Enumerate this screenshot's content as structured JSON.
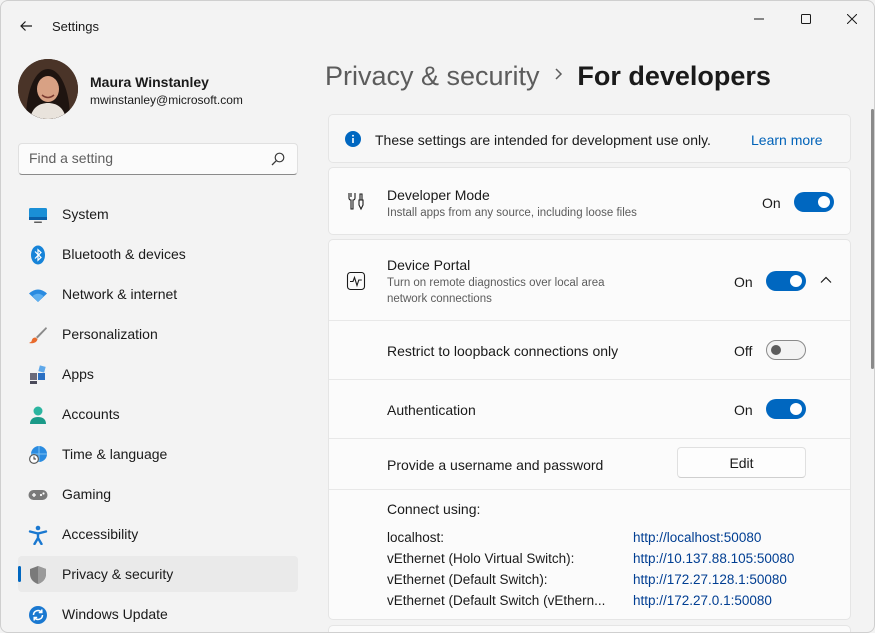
{
  "window": {
    "title": "Settings"
  },
  "profile": {
    "name": "Maura Winstanley",
    "email": "mwinstanley@microsoft.com"
  },
  "search": {
    "placeholder": "Find a setting"
  },
  "sidebar": {
    "items": [
      {
        "label": "System",
        "icon": "system-icon"
      },
      {
        "label": "Bluetooth & devices",
        "icon": "bluetooth-icon"
      },
      {
        "label": "Network & internet",
        "icon": "wifi-icon"
      },
      {
        "label": "Personalization",
        "icon": "brush-icon"
      },
      {
        "label": "Apps",
        "icon": "apps-icon"
      },
      {
        "label": "Accounts",
        "icon": "person-icon"
      },
      {
        "label": "Time & language",
        "icon": "globe-clock-icon"
      },
      {
        "label": "Gaming",
        "icon": "gamepad-icon"
      },
      {
        "label": "Accessibility",
        "icon": "accessibility-icon"
      },
      {
        "label": "Privacy & security",
        "icon": "shield-icon",
        "active": true
      },
      {
        "label": "Windows Update",
        "icon": "sync-icon"
      }
    ]
  },
  "breadcrumb": {
    "parent": "Privacy & security",
    "current": "For developers"
  },
  "info": {
    "text": "These settings are intended for development use only.",
    "link": "Learn more"
  },
  "developer_mode": {
    "title": "Developer Mode",
    "description": "Install apps from any source, including loose files",
    "state": "On"
  },
  "device_portal": {
    "title": "Device Portal",
    "description_line1": "Turn on remote diagnostics over local area",
    "description_line2": "network connections",
    "state": "On",
    "loopback": {
      "label": "Restrict to loopback connections only",
      "state": "Off"
    },
    "authentication": {
      "label": "Authentication",
      "state": "On"
    },
    "credentials": {
      "label": "Provide a username and password",
      "button": "Edit"
    },
    "connect": {
      "label": "Connect using:",
      "rows": [
        {
          "name": "localhost:",
          "url": "http://localhost:50080"
        },
        {
          "name": "vEthernet (Holo Virtual Switch):",
          "url": "http://10.137.88.105:50080"
        },
        {
          "name": "vEthernet (Default Switch):",
          "url": "http://172.27.128.1:50080"
        },
        {
          "name": "vEthernet (Default Switch (vEthern...",
          "url": "http://172.27.0.1:50080"
        }
      ]
    }
  },
  "colors": {
    "accent": "#0067c0",
    "link": "#0062b8"
  }
}
